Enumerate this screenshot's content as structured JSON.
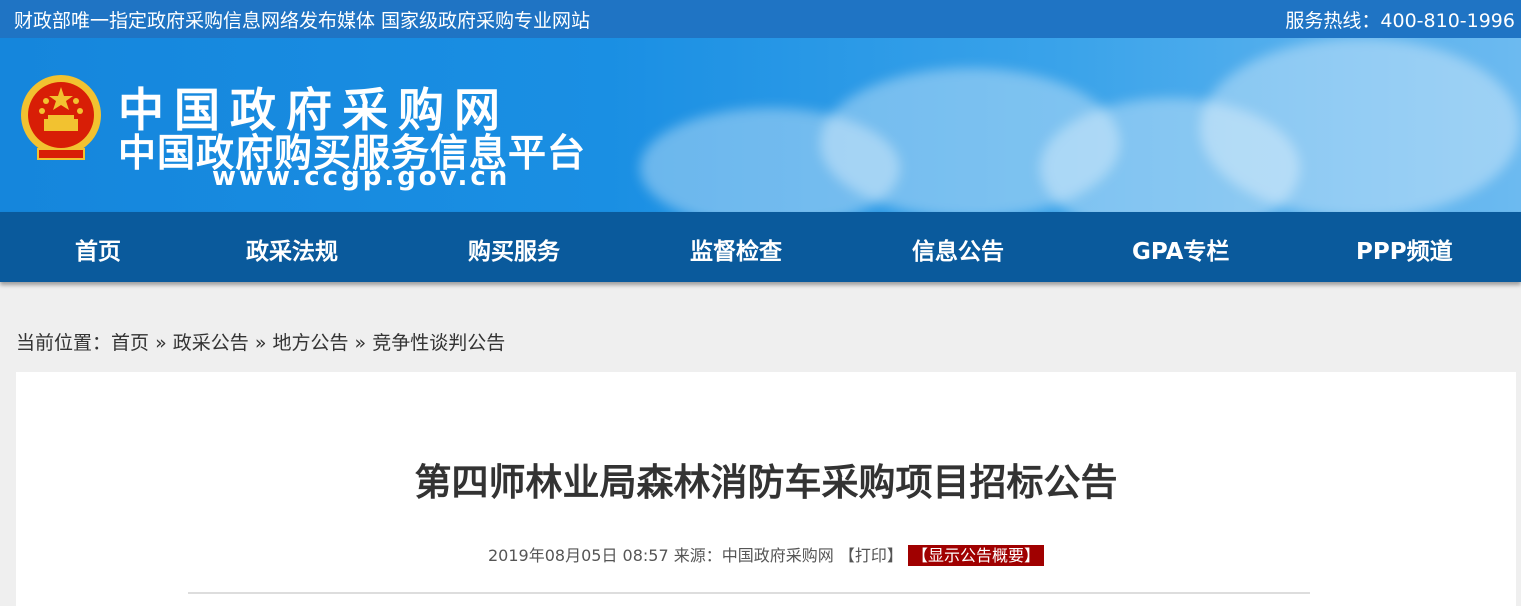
{
  "topbar": {
    "slogan": "财政部唯一指定政府采购信息网络发布媒体 国家级政府采购专业网站",
    "hotline": "服务热线：400-810-1996"
  },
  "banner": {
    "line1": "中国政府采购网",
    "line2": "中国政府购买服务信息平台",
    "url": "www.ccgp.gov.cn",
    "emblem": "national-emblem"
  },
  "nav": {
    "items": [
      {
        "label": "首页"
      },
      {
        "label": "政采法规"
      },
      {
        "label": "购买服务"
      },
      {
        "label": "监督检查"
      },
      {
        "label": "信息公告"
      },
      {
        "label": "GPA专栏"
      },
      {
        "label": "PPP频道"
      }
    ]
  },
  "breadcrumb": {
    "prefix": "当前位置：",
    "items": [
      "首页",
      "政采公告",
      "地方公告",
      "竞争性谈判公告"
    ],
    "separator": "»"
  },
  "article": {
    "title": "第四师林业局森林消防车采购项目招标公告",
    "datetime": "2019年08月05日 08:57",
    "source_label": "来源：",
    "source": "中国政府采购网",
    "print_label": "【打印】",
    "summary_label": "【显示公告概要】"
  },
  "colors": {
    "topbar": "#1f74c4",
    "nav": "#0a5a9c",
    "summary_button": "#a00000"
  }
}
